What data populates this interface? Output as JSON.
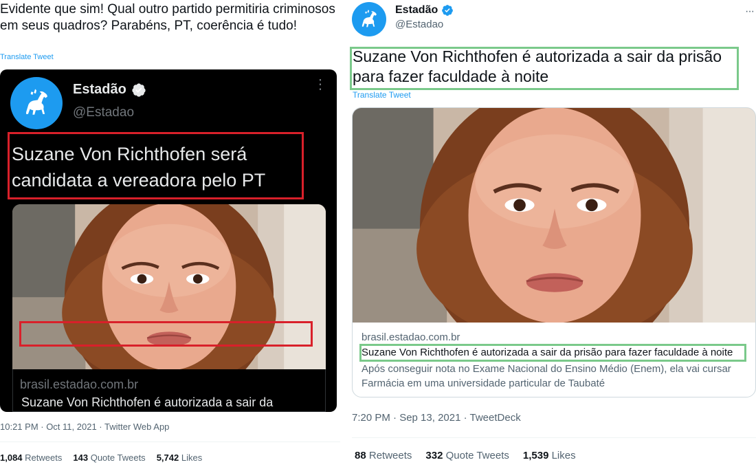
{
  "left_tweet": {
    "text": "Evidente que sim! Qual outro partido permitiria criminosos em seus quadros? Parabéns, PT, coerência é tudo!",
    "translate_label": "Translate Tweet",
    "screenshot": {
      "name": "Estadão",
      "handle": "@Estadao",
      "more": "⋮",
      "headline": "Suzane Von Richthofen  será candidata a vereadora pelo PT",
      "link_domain": "brasil.estadao.com.br",
      "link_title": "Suzane Von Richthofen é autorizada a sair da"
    },
    "meta": "10:21 PM · Oct 11, 2021 · Twitter Web App",
    "stats": {
      "retweets_count": "1,084",
      "retweets_label": "Retweets",
      "quotes_count": "143",
      "quotes_label": "Quote Tweets",
      "likes_count": "5,742",
      "likes_label": "Likes"
    }
  },
  "right_tweet": {
    "name": "Estadão",
    "handle": "@Estadao",
    "more": "···",
    "headline": "Suzane Von Richthofen é autorizada a sair da prisão para fazer faculdade à noite",
    "translate_label": "Translate Tweet",
    "card": {
      "domain": "brasil.estadao.com.br",
      "title": "Suzane Von Richthofen é autorizada a sair da prisão para fazer faculdade à noite",
      "description": "Após conseguir nota no Exame Nacional do Ensino Médio (Enem), ela vai cursar Farmácia em uma universidade particular de Taubaté"
    },
    "meta": "7:20 PM · Sep 13, 2021 · TweetDeck",
    "stats": {
      "retweets_count": "88",
      "retweets_label": "Retweets",
      "quotes_count": "332",
      "quotes_label": "Quote Tweets",
      "likes_count": "1,539",
      "likes_label": "Likes"
    }
  },
  "colors": {
    "twitter_blue": "#1d9bf0",
    "highlight_red": "#d9202a",
    "highlight_green": "#7ac98a"
  },
  "icons": [
    "verified-badge-icon",
    "estadao-horse-logo-icon",
    "more-options-icon"
  ]
}
